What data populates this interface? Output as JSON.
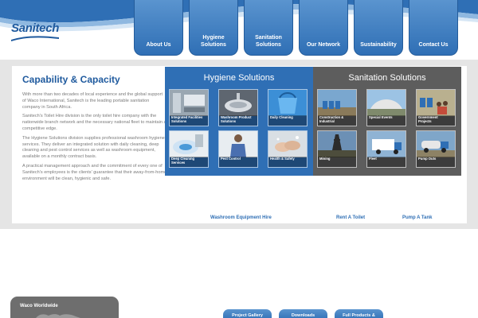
{
  "brand": {
    "logo_text": "Sanitech",
    "accent": "#2f6fb5",
    "dark": "#5d5d5d"
  },
  "nav": [
    {
      "label": "About Us"
    },
    {
      "label": "Hygiene Solutions"
    },
    {
      "label": "Sanitation\nSolutions"
    },
    {
      "label": "Our Network"
    },
    {
      "label": "Sustainability"
    },
    {
      "label": "Contact Us"
    }
  ],
  "intro": {
    "title": "Capability & Capacity",
    "paragraphs": [
      "With more than two decades of local experience and the global support of Waco International, Sanitech is the leading portable sanitation company in South Africa.",
      "Sanitech's Toilet Hire division is the only toilet hire company with the nationwide branch network and the necessary national fleet to maintain a competitive edge.",
      "The Hygiene Solutions division supplies professional washroom hygiene services. They deliver an integrated solution with daily cleaning, deep cleaning and pest control services as well as washroom equipment, available on a monthly contract basis.",
      "A practical management approach and the commitment of every one of Sanitech's employees is the clients' guarantee that their away-from-home environment will be clean, hygienic and safe."
    ]
  },
  "hygiene": {
    "title": "Hygiene Solutions",
    "tiles": [
      {
        "label": "Integrated Facilities\nSolutions",
        "icon": "washroom-photo"
      },
      {
        "label": "Washroom Product\nSolutions",
        "icon": "basin-photo"
      },
      {
        "label": "Daily Cleaning",
        "icon": "bucket-photo"
      },
      {
        "label": "Deep Cleaning\nServices",
        "icon": "cleaning-photo"
      },
      {
        "label": "Pest Control",
        "icon": "technician-photo"
      },
      {
        "label": "Health & Safety",
        "icon": "handwash-photo"
      }
    ]
  },
  "sanitation": {
    "title": "Sanitation Solutions",
    "tiles": [
      {
        "label": "Construction &\nIndustrial",
        "icon": "construction-photo"
      },
      {
        "label": "Special Events",
        "icon": "stadium-photo"
      },
      {
        "label": "Government\nProjects",
        "icon": "community-photo"
      },
      {
        "label": "Mining",
        "icon": "mine-photo"
      },
      {
        "label": "Fleet",
        "icon": "truck-photo"
      },
      {
        "label": "Pump Outs",
        "icon": "pump-truck-photo"
      }
    ]
  },
  "links": {
    "washroom": "Washroom Equipment Hire",
    "rent": "Rent A Toilet",
    "pump": "Pump A Tank"
  },
  "footer": {
    "world_title": "Waco Worldwide",
    "buttons": [
      "Project Gallery",
      "Downloads",
      "Full Products &"
    ]
  }
}
